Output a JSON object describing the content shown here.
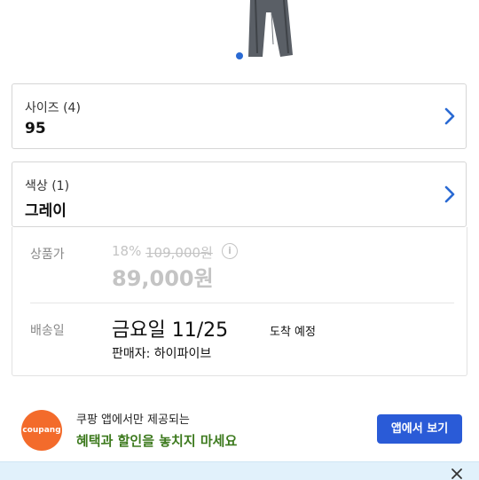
{
  "product": {
    "image_icon": "pants-product-image",
    "carousel": {
      "active_index": 0
    }
  },
  "options": {
    "size": {
      "label": "사이즈 (4)",
      "value": "95"
    },
    "color": {
      "label": "색상 (1)",
      "value": "그레이"
    }
  },
  "price": {
    "label": "상품가",
    "discount_rate": "18%",
    "original_price": "109,000원",
    "sale_price": "89,000원"
  },
  "delivery": {
    "label": "배송일",
    "date": "금요일 11/25",
    "suffix": "도착 예정",
    "seller": "판매자: 하이파이브"
  },
  "promo": {
    "logo_text": "coupang",
    "line1": "쿠팡 앱에서만 제공되는",
    "line2": "혜택과 할인을 놓치지 마세요",
    "button_label": "앱에서 보기"
  },
  "colors": {
    "accent": "#2a5bd7",
    "promo_green": "#3d7a1e",
    "logo_orange": "#f36b2b",
    "muted": "#c4c4c4"
  }
}
